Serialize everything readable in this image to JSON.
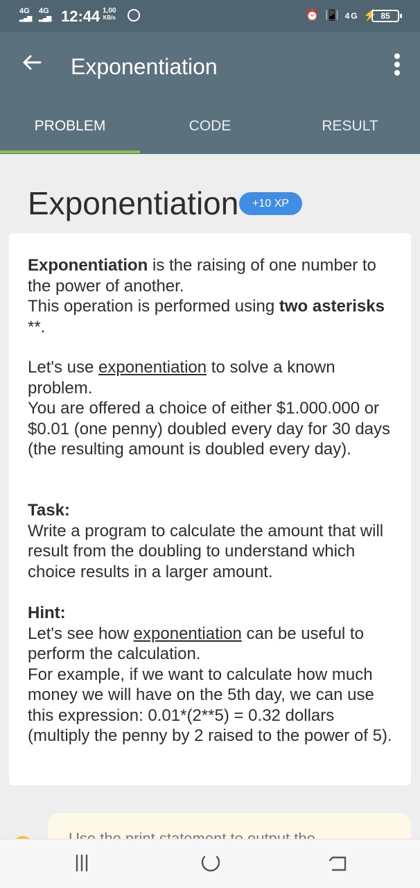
{
  "status_bar": {
    "sim1": "4G",
    "sim2": "4G",
    "time": "12:44",
    "speed_value": "1,00",
    "speed_unit": "KB/s",
    "network": "4G",
    "battery": "85"
  },
  "app_bar": {
    "back_icon": "arrow-left-icon",
    "title": "Exponentiation",
    "menu_icon": "more-vert-icon"
  },
  "tabs": [
    {
      "label": "PROBLEM",
      "active": true
    },
    {
      "label": "CODE",
      "active": false
    },
    {
      "label": "RESULT",
      "active": false
    }
  ],
  "lesson": {
    "heading": "Exponentiation",
    "xp": "+10 XP",
    "p1": {
      "term": "Exponentiation",
      "rest_line1": " is the raising of one number to the power of another.",
      "line2_start": "This operation is performed using ",
      "bold_two": "two asterisks",
      "asterisks": " **."
    },
    "p2": {
      "start": "Let's use ",
      "link": "exponentiation",
      "rest": " to solve a known problem.",
      "line2": "You are offered a choice of either $1.000.000 or $0.01 (one penny) doubled every day for 30 days (the resulting amount is doubled every day)."
    },
    "task": {
      "label": "Task:",
      "text": "Write a program to calculate the amount that will result from the doubling to understand which choice results in a larger amount."
    },
    "hint": {
      "label": "Hint:",
      "start": "Let's see how ",
      "link": "exponentiation",
      "rest": " can be useful to perform the calculation.",
      "text": "For example, if we want to calculate how much money we will have on the 5th day, we can use this expression: 0.01*(2**5) = 0.32 dollars (multiply the penny by 2 raised to the power of 5)."
    }
  },
  "note": {
    "text": "Use the print statement to output the"
  },
  "nav_bar": {
    "recents_icon": "menu-lines-icon",
    "home_icon": "home-arc-icon",
    "back_icon": "back-arrow-icon"
  },
  "colors": {
    "status_bar": "#4f6571",
    "app_bar": "#5b717d",
    "tab_indicator": "#8bc34a",
    "xp_badge": "#3f8ee4"
  }
}
